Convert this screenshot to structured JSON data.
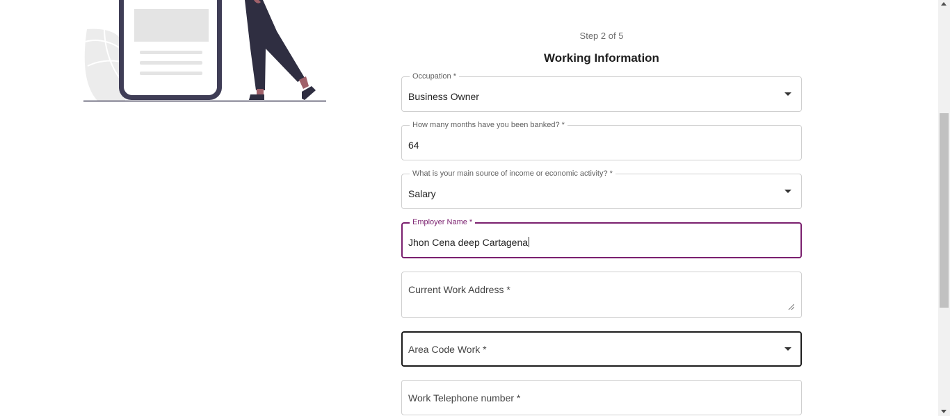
{
  "form": {
    "step_text": "Step 2 of 5",
    "section_title": "Working Information",
    "fields": {
      "occupation": {
        "label": "Occupation *",
        "value": "Business Owner"
      },
      "months_banked": {
        "label": "How many months have you been banked? *",
        "value": "64"
      },
      "income_source": {
        "label": "What is your main source of income or economic activity? *",
        "value": "Salary"
      },
      "employer_name": {
        "label": "Employer Name *",
        "value": "Jhon Cena deep Cartagena"
      },
      "work_address": {
        "placeholder": "Current Work Address *"
      },
      "area_code_work": {
        "placeholder": "Area Code Work *"
      },
      "work_phone": {
        "placeholder": "Work Telephone number *"
      }
    }
  },
  "colors": {
    "accent": "#7a1f6e",
    "illustration_dark": "#3f3d56",
    "illustration_skin": "#a0616a"
  },
  "icons": {
    "dropdown": "chevron-down-icon",
    "resize": "resize-grip-icon"
  }
}
